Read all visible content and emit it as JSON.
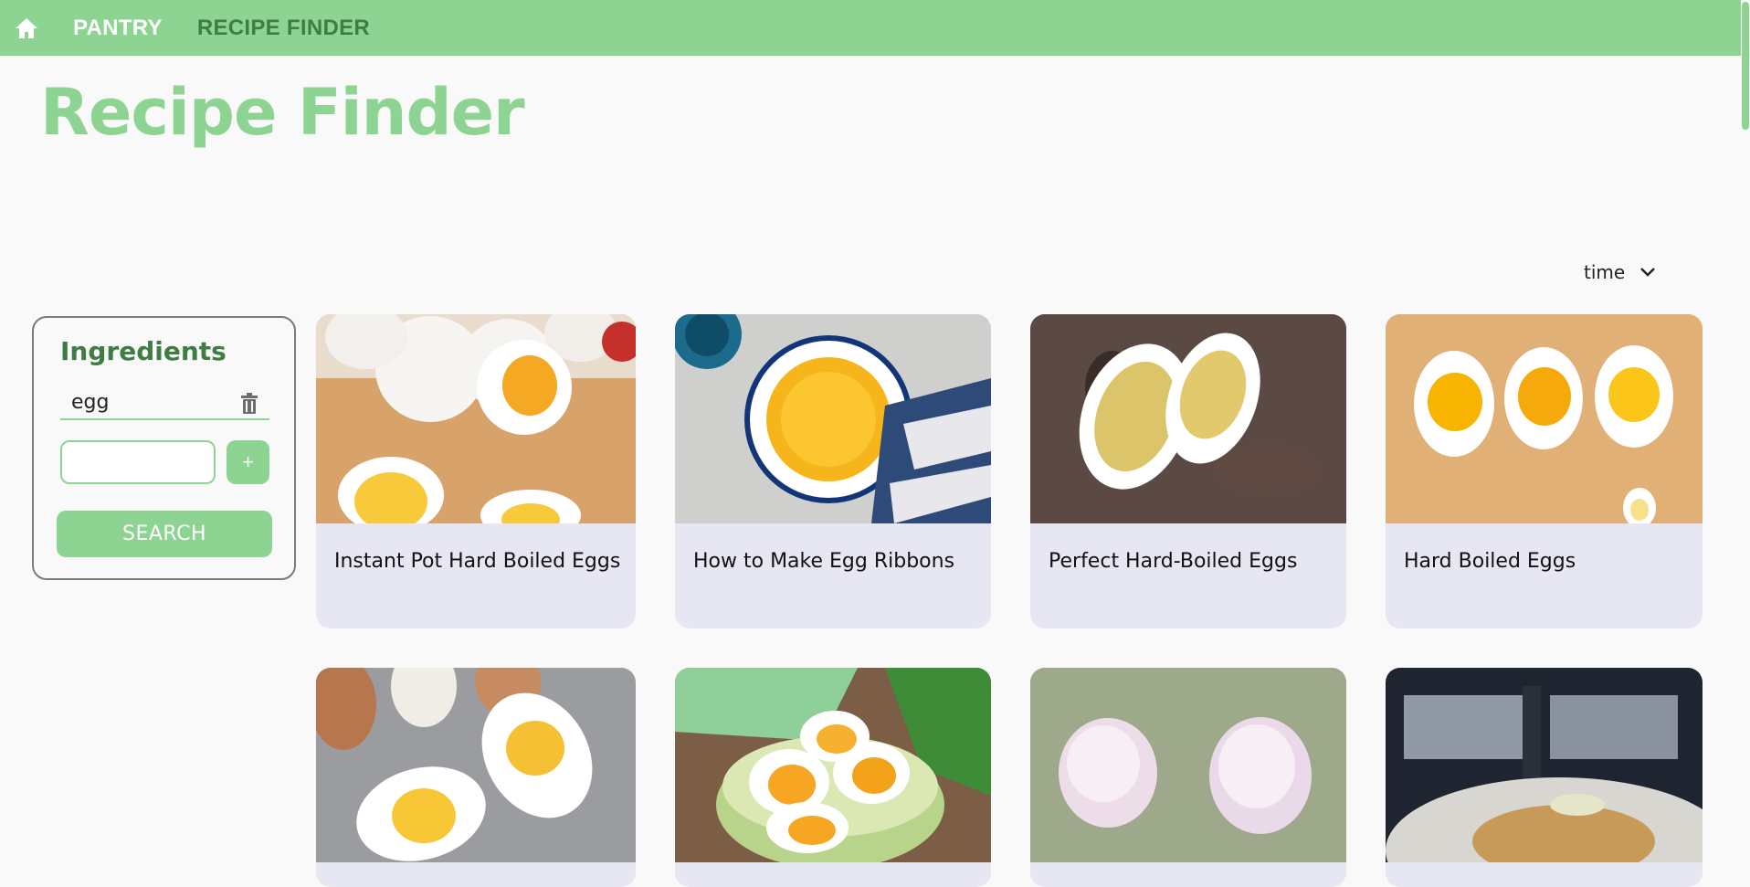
{
  "nav": {
    "home_icon": "home-icon",
    "links": [
      "PANTRY",
      "RECIPE FINDER"
    ]
  },
  "page": {
    "title": "Recipe Finder"
  },
  "sort": {
    "selected": "time",
    "icon": "chevron-down-icon"
  },
  "ingredients": {
    "title": "Ingredients",
    "items": [
      {
        "name": "egg",
        "icon": "trash-icon"
      }
    ],
    "input_value": "",
    "add_label": "+",
    "search_label": "SEARCH"
  },
  "recipes": [
    {
      "title": "Instant Pot Hard Boiled Eggs"
    },
    {
      "title": "How to Make Egg Ribbons"
    },
    {
      "title": "Perfect Hard-Boiled Eggs"
    },
    {
      "title": "Hard Boiled Eggs"
    },
    {
      "title": ""
    },
    {
      "title": ""
    },
    {
      "title": ""
    },
    {
      "title": ""
    }
  ],
  "colors": {
    "accent": "#8dd493",
    "accent_dark": "#3f7d45",
    "card_bg": "#e7e6f3"
  }
}
